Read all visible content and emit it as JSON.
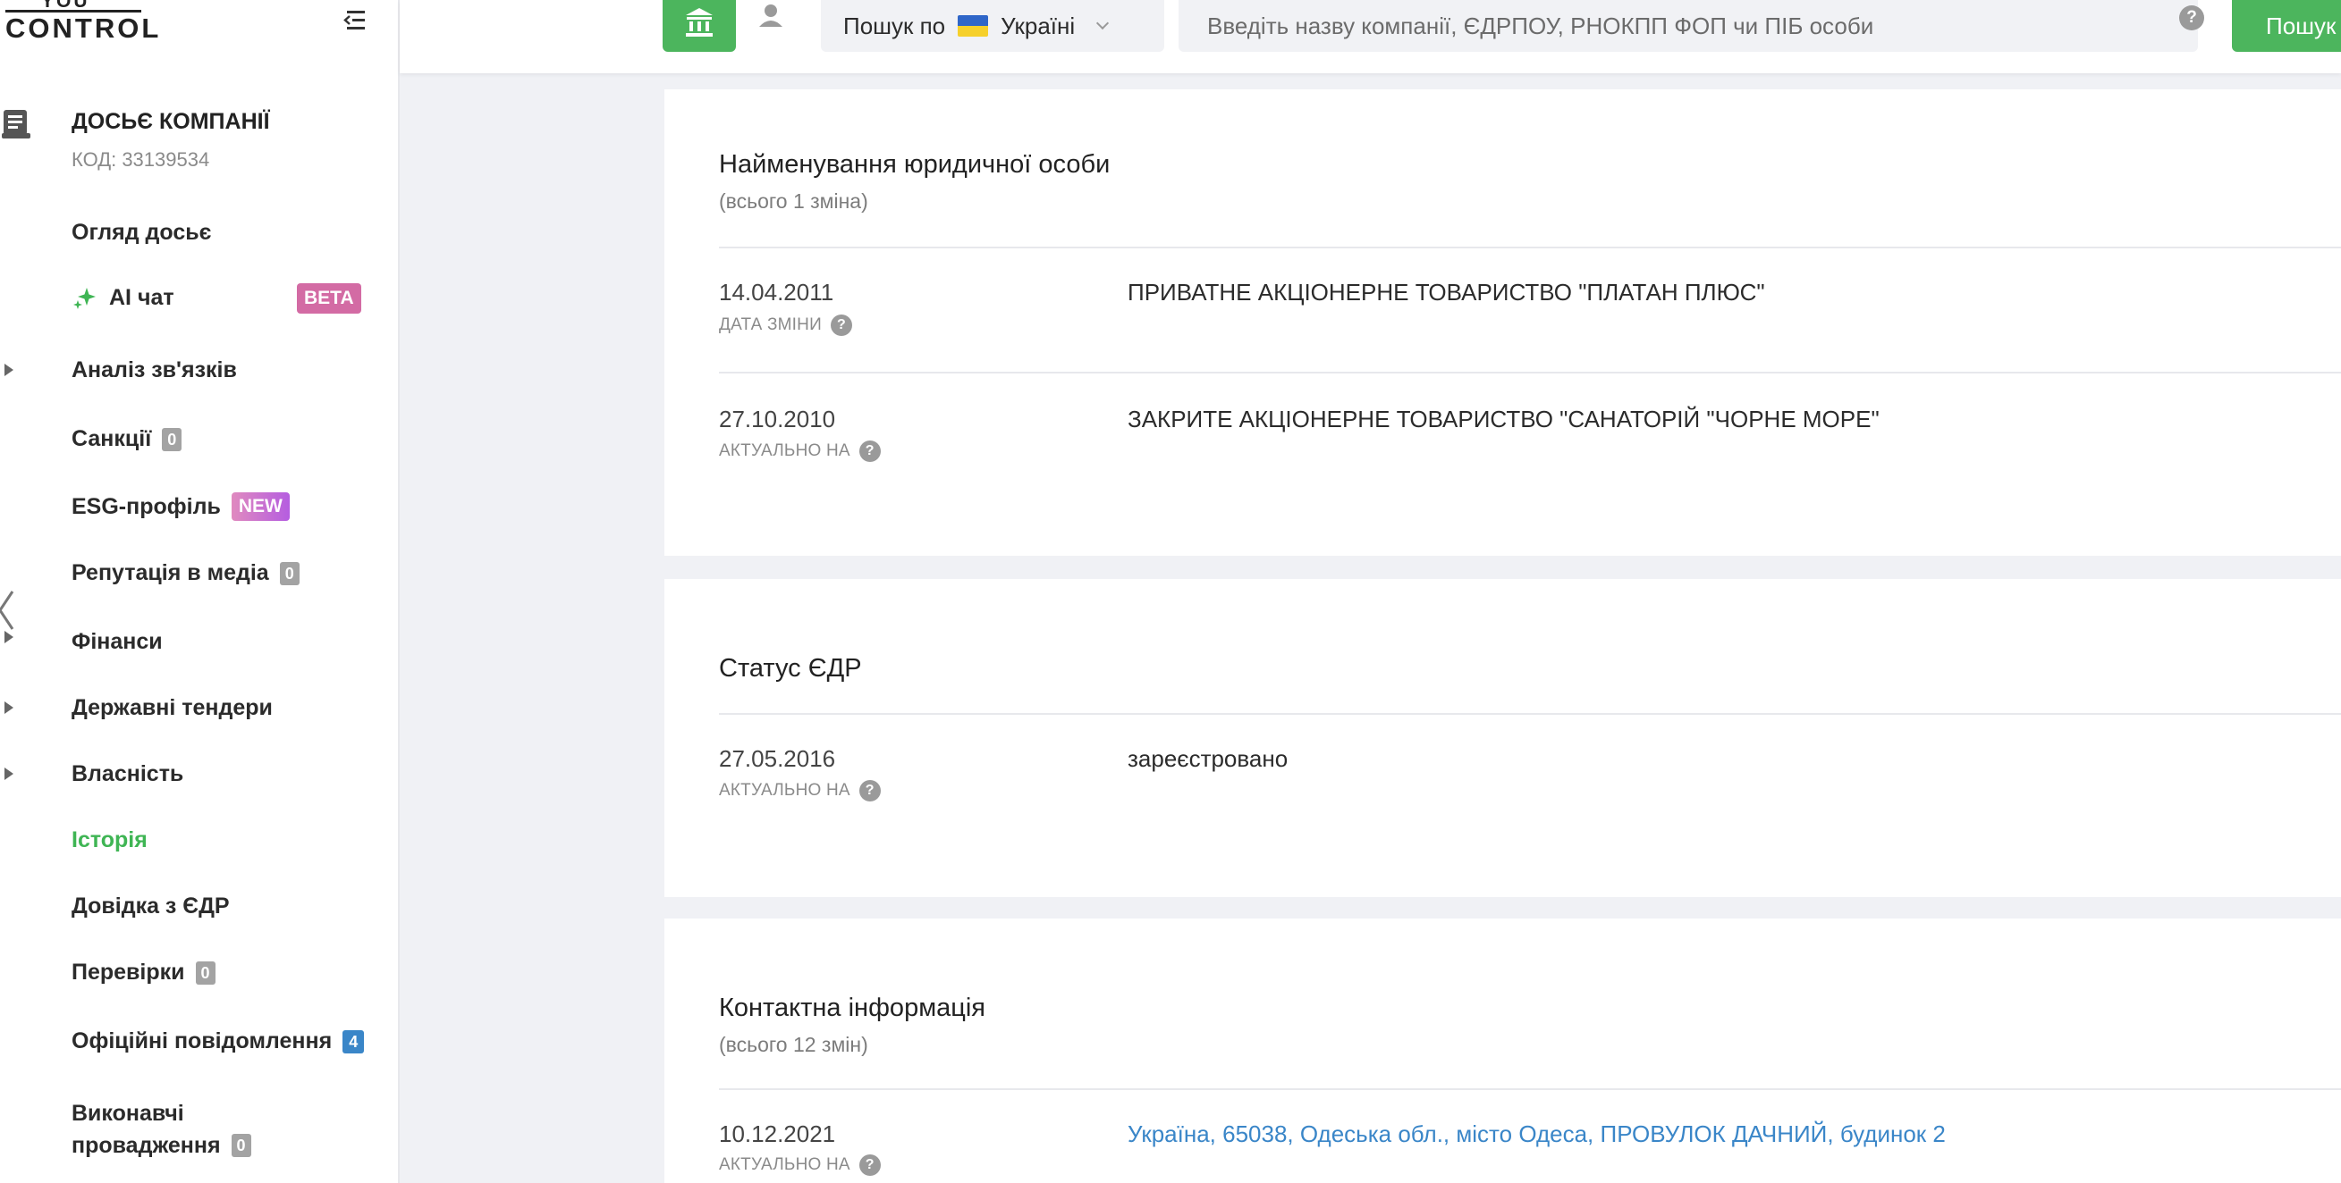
{
  "logo": {
    "top": "YOU",
    "bottom": "CONTROL"
  },
  "sidebar": {
    "dossier_title": "ДОСЬЄ КОМПАНІЇ",
    "dossier_code": "КОД: 33139534",
    "items": [
      {
        "label": "Огляд досьє"
      },
      {
        "label": "AI чат",
        "badge": "BETA"
      },
      {
        "label": "Аналіз зв'язків"
      },
      {
        "label": "Санкції",
        "badge": "0"
      },
      {
        "label": "ESG-профіль",
        "badge": "NEW"
      },
      {
        "label": "Репутація в медіа",
        "badge": "0"
      },
      {
        "label": "Фінанси"
      },
      {
        "label": "Державні тендери"
      },
      {
        "label": "Власність"
      },
      {
        "label": "Історія"
      },
      {
        "label": "Довідка з ЄДР"
      },
      {
        "label": "Перевірки",
        "badge": "0"
      },
      {
        "label": "Офіційні повідомлення",
        "badge": "4"
      },
      {
        "label_line1": "Виконавчі",
        "label_line2": "провадження",
        "badge": "0"
      }
    ]
  },
  "topbar": {
    "scope_prefix": "Пошук по",
    "scope_country": "Україні",
    "search_placeholder": "Введіть назву компанії, ЄДРПОУ, РНОКПП ФОП чи ПІБ особи",
    "help": "?",
    "search_button": "Пошук"
  },
  "sections": [
    {
      "title": "Найменування юридичної особи",
      "subtitle": "(всього 1 зміна)",
      "rows": [
        {
          "date": "14.04.2011",
          "label": "ДАТА ЗМІНИ",
          "value": "ПРИВАТНЕ АКЦІОНЕРНЕ ТОВАРИСТВО \"ПЛАТАН ПЛЮС\""
        },
        {
          "date": "27.10.2010",
          "label": "АКТУАЛЬНО НА",
          "value": "ЗАКРИТЕ АКЦІОНЕРНЕ ТОВАРИСТВО \"САНАТОРІЙ \"ЧОРНЕ МОРЕ\""
        }
      ]
    },
    {
      "title": "Статус ЄДР",
      "rows": [
        {
          "date": "27.05.2016",
          "label": "АКТУАЛЬНО НА",
          "value": "зареєстровано"
        }
      ]
    },
    {
      "title": "Контактна інформація",
      "subtitle": "(всього 12 змін)",
      "rows": [
        {
          "date": "10.12.2021",
          "label": "АКТУАЛЬНО НА",
          "value": "Україна, 65038, Одеська обл., місто Одеса, ПРОВУЛОК ДАЧНИЙ, будинок 2"
        }
      ]
    }
  ],
  "colors": {
    "accent_green": "#4cb55d",
    "link_blue": "#3a86c8",
    "beta_pink": "#d36ba4"
  },
  "help_glyph": "?"
}
